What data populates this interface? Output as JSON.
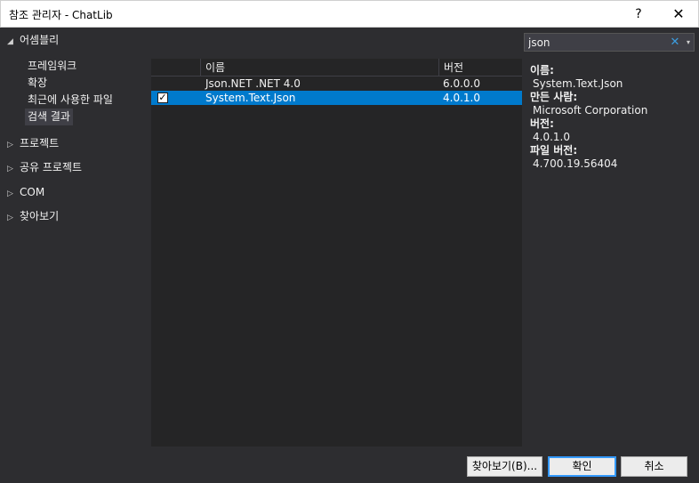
{
  "window": {
    "title": "참조 관리자 - ChatLib",
    "help_label": "?",
    "close_label": "✕"
  },
  "nav": {
    "assemblies": {
      "label": "어셈블리",
      "expanded": true,
      "children": [
        "프레임워크",
        "확장",
        "최근에 사용한 파일",
        "검색 결과"
      ],
      "selected_child": "검색 결과"
    },
    "projects": "프로젝트",
    "shared_projects": "공유 프로젝트",
    "com": "COM",
    "browse": "찾아보기"
  },
  "list": {
    "columns": [
      "이름",
      "버전"
    ],
    "rows": [
      {
        "checked": false,
        "name": "Json.NET .NET 4.0",
        "version": "6.0.0.0",
        "selected": false
      },
      {
        "checked": true,
        "name": "System.Text.Json",
        "version": "4.0.1.0",
        "selected": true
      }
    ]
  },
  "search": {
    "value": "json",
    "clear_icon": "✕",
    "dropdown_icon": "▾"
  },
  "details": {
    "name_label": "이름:",
    "name_value": "System.Text.Json",
    "author_label": "만든 사람:",
    "author_value": "Microsoft Corporation",
    "version_label": "버전:",
    "version_value": "4.0.1.0",
    "file_version_label": "파일 버전:",
    "file_version_value": "4.700.19.56404"
  },
  "footer": {
    "browse_button": "찾아보기(B)...",
    "ok_button": "확인",
    "cancel_button": "취소"
  },
  "colors": {
    "accent": "#007acc",
    "background": "#2d2d30",
    "panel": "#252526"
  }
}
